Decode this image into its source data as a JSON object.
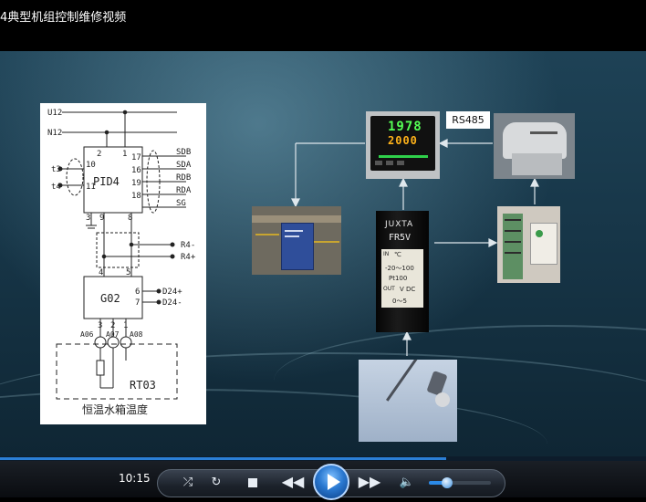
{
  "window": {
    "title": "4典型机组控制维修视频"
  },
  "schematic": {
    "lines": [
      "U12",
      "N12"
    ],
    "pid_label": "PID4",
    "pid_pins_top": [
      "2",
      "1"
    ],
    "pid_pins_right": [
      "17",
      "16",
      "19",
      "18"
    ],
    "pid_pins_left": [
      "10",
      "11"
    ],
    "pid_pins_bottom": [
      "3",
      "9",
      "8"
    ],
    "signals": [
      "SDB",
      "SDA",
      "RDB",
      "RDA",
      "SG"
    ],
    "inputs": [
      "t3",
      "t4"
    ],
    "r_labels": [
      "R4-",
      "R4+"
    ],
    "go2_label": "G02",
    "go2_pins_top": [
      "4",
      "5"
    ],
    "go2_pins_right": [
      "6",
      "7"
    ],
    "go2_pins_bottom": [
      "3",
      "2",
      "1"
    ],
    "d_labels": [
      "D24+",
      "D24-"
    ],
    "sensors": [
      "A06",
      "A07",
      "A08"
    ],
    "rt_label": "RT03",
    "caption": "恒温水箱温度"
  },
  "controller": {
    "pv": "1978",
    "sv": "2000"
  },
  "transmitter": {
    "brand": "JUXTA",
    "model": "FR5V",
    "in_label": "IN",
    "unit": "℃",
    "range": "-20～100",
    "pt": "Pt100",
    "out_label": "OUT",
    "vdc": "V DC",
    "out_range": "0～5"
  },
  "rs485_label": "RS485",
  "player": {
    "time": "10:15",
    "progress": 0.69,
    "volume": 0.3,
    "buttons": [
      "shuffle-icon",
      "repeat-icon",
      "stop-icon",
      "rewind-icon",
      "play-icon",
      "fast-forward-icon",
      "volume-icon"
    ]
  },
  "colors": {
    "accent": "#2b7fd6",
    "controller_display": "#55ff55",
    "sv_display": "#ffb31a"
  }
}
